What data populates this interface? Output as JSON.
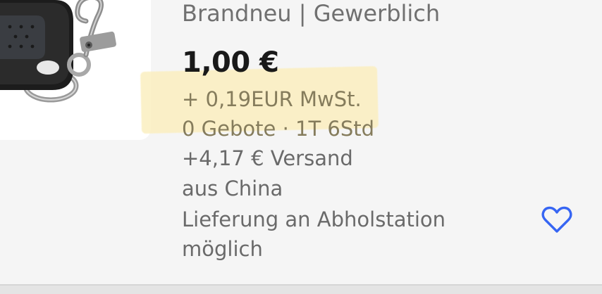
{
  "listing": {
    "condition": "Brandneu | Gewerblich",
    "price": "1,00 €",
    "tax": "+ 0,19EUR MwSt.",
    "bids_time": "0 Gebote · 1T 6Std",
    "shipping": "+4,17 € Versand",
    "origin": "aus China",
    "pickup_line1": "Lieferung an Abholstation",
    "pickup_line2": "möglich"
  },
  "icons": {
    "watch": "heart-icon",
    "product": "remote-keyfob-image"
  },
  "colors": {
    "background": "#f5f5f5",
    "price": "#191919",
    "secondary_text": "#6e6e6e",
    "highlight": "#fbefc0",
    "heart": "#3665f3"
  }
}
